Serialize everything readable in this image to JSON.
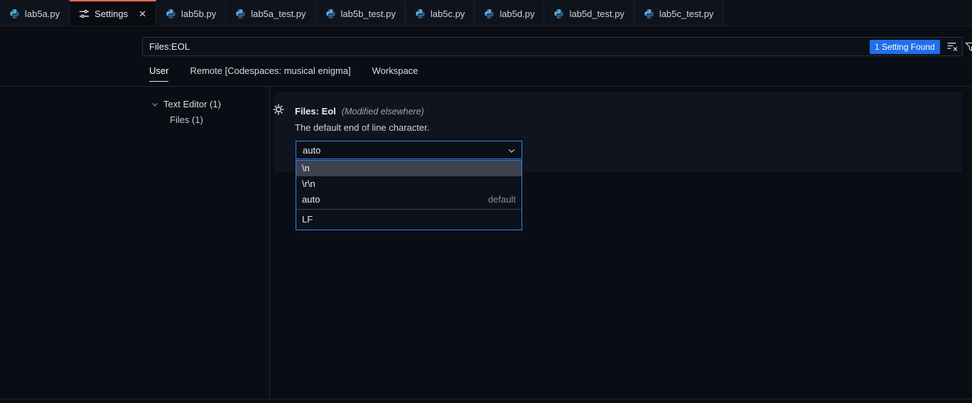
{
  "tabs": [
    {
      "label": "lab5a.py"
    },
    {
      "label": "Settings"
    },
    {
      "label": "lab5b.py"
    },
    {
      "label": "lab5a_test.py"
    },
    {
      "label": "lab5b_test.py"
    },
    {
      "label": "lab5c.py"
    },
    {
      "label": "lab5d.py"
    },
    {
      "label": "lab5d_test.py"
    },
    {
      "label": "lab5c_test.py"
    }
  ],
  "search": {
    "value": "Files:EOL",
    "results_badge": "1 Setting Found"
  },
  "scopes": [
    {
      "label": "User"
    },
    {
      "label": "Remote [Codespaces: musical enigma]"
    },
    {
      "label": "Workspace"
    }
  ],
  "toc": {
    "text_editor": "Text Editor (1)",
    "files": "Files (1)"
  },
  "setting": {
    "title": "Files: Eol",
    "modified_note": "(Modified elsewhere)",
    "description": "The default end of line character.",
    "value": "auto",
    "options": [
      {
        "label": "\\n"
      },
      {
        "label": "\\r\\n"
      },
      {
        "label": "auto",
        "detail": "default"
      }
    ],
    "option_description": "LF"
  },
  "colors": {
    "active_tab_accent": "#ec6a4f",
    "focus_border_blue": "#2f81f7",
    "badge_blue": "#1f6feb"
  }
}
